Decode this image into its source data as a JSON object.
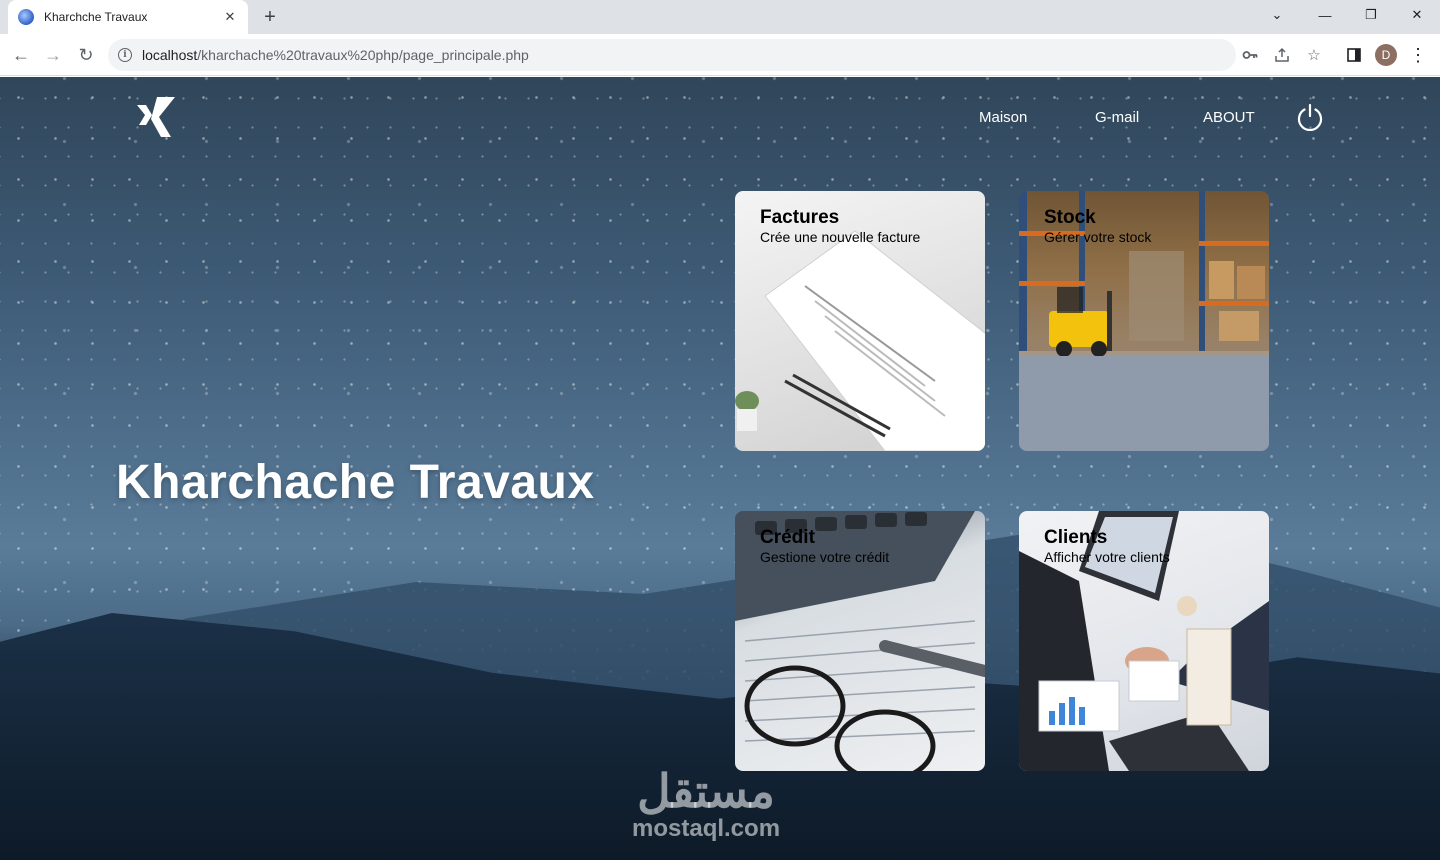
{
  "browser": {
    "tab_title": "Kharchche Travaux",
    "url_host": "localhost",
    "url_path": "/kharchache%20travaux%20php/page_principale.php",
    "profile_initial": "D"
  },
  "page": {
    "nav": {
      "home": "Maison",
      "email": "G-mail",
      "about": "ABOUT"
    },
    "hero_title": "Kharchache Travaux",
    "cards": [
      {
        "title": "Factures",
        "subtitle": "Crée une nouvelle facture"
      },
      {
        "title": "Stock",
        "subtitle": "Gérer votre stock"
      },
      {
        "title": "Crédit",
        "subtitle": "Gestione votre crédit"
      },
      {
        "title": "Clients",
        "subtitle": "Afficher votre clients"
      }
    ],
    "watermark_ar": "مستقل",
    "watermark_en": "mostaql.com"
  },
  "colors": {
    "nav_text": "#ffffff",
    "card_text": "#000000"
  }
}
